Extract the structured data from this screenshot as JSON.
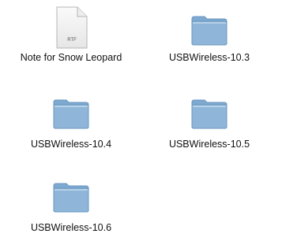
{
  "items": [
    {
      "label": "Note for Snow Leopard",
      "type": "document",
      "icon": "rtf-document-icon",
      "badge": "RTF"
    },
    {
      "label": "USBWireless-10.3",
      "type": "folder",
      "icon": "folder-icon"
    },
    {
      "label": "USBWireless-10.4",
      "type": "folder",
      "icon": "folder-icon"
    },
    {
      "label": "USBWireless-10.5",
      "type": "folder",
      "icon": "folder-icon"
    },
    {
      "label": "USBWireless-10.6",
      "type": "folder",
      "icon": "folder-icon"
    }
  ],
  "colors": {
    "folder_body": "#8fb6d8",
    "folder_tab": "#7ea9d0",
    "folder_edge": "#6a97c0"
  }
}
